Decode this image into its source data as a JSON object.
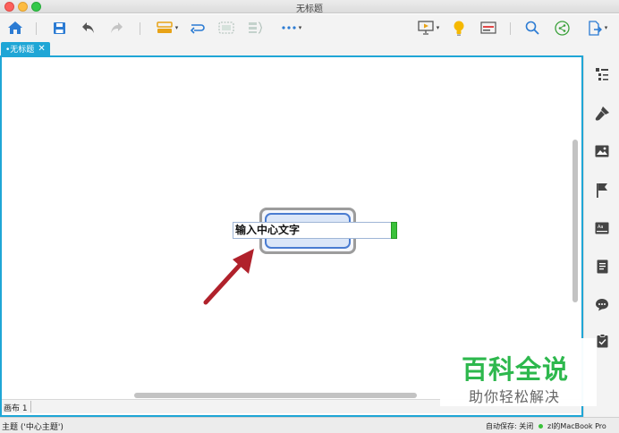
{
  "window": {
    "title": "无标题"
  },
  "toolbar": {
    "icons": [
      "home-icon",
      "save-icon",
      "undo-icon",
      "redo-icon",
      "insert-topic-icon",
      "relationship-icon",
      "boundary-icon",
      "summary-icon",
      "more-icon",
      "presentation-icon",
      "idea-icon",
      "outline-icon",
      "search-icon",
      "share-icon",
      "export-icon"
    ]
  },
  "tabs": [
    {
      "label": "•无标题",
      "close": "✕"
    }
  ],
  "canvas": {
    "central_topic_edit_text": "输入中心文字"
  },
  "sheet": {
    "label": "画布 1"
  },
  "sidebar": {
    "icons": [
      "outline-panel-icon",
      "format-brush-icon",
      "image-icon",
      "flag-icon",
      "label-icon",
      "notes-icon",
      "comment-icon",
      "task-icon"
    ]
  },
  "status": {
    "topic": "主题 ('中心主题')",
    "autosave": "自动保存: 关闭",
    "user": "zl的MacBook Pro"
  },
  "watermark": {
    "main": "百科全说",
    "sub": "助你轻松解决"
  },
  "colors": {
    "accent": "#1fa6d6",
    "arrow": "#b0212b",
    "topic_border": "#4a7cd1",
    "watermark_green": "#2db84d"
  }
}
